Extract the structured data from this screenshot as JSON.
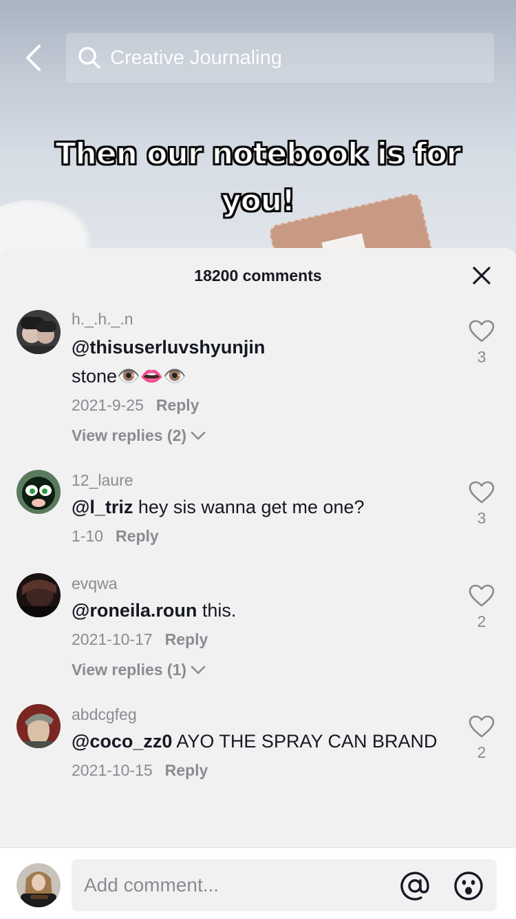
{
  "search": {
    "placeholder": "Creative Journaling"
  },
  "video": {
    "caption_line1": "Then our notebook is for",
    "caption_line2": "you!"
  },
  "comments_panel": {
    "title": "18200 comments",
    "reply_label": "Reply",
    "comments": [
      {
        "username": "h._.h._.n",
        "mention": "@thisuserluvshyunjin",
        "text": "",
        "text_line2": "stone👁️👄👁️",
        "date": "2021-9-25",
        "likes": "3",
        "view_replies": "View replies (2)"
      },
      {
        "username": "12_laure",
        "mention": "@l_triz",
        "text": " hey sis wanna get me one?",
        "date": "1-10",
        "likes": "3"
      },
      {
        "username": "evqwa",
        "mention": "@roneila.roun",
        "text": " this.",
        "date": "2021-10-17",
        "likes": "2",
        "view_replies": "View replies (1)"
      },
      {
        "username": "abdcgfeg",
        "mention": "@coco_zz0",
        "text": " AYO THE SPRAY CAN BRAND",
        "date": "2021-10-15",
        "likes": "2"
      }
    ]
  },
  "composer": {
    "placeholder": "Add comment..."
  },
  "colors": {
    "sheet_bg": "#f1f1f2",
    "text_primary": "#161823",
    "text_secondary": "#8a8b91"
  },
  "icons": [
    "back-arrow-icon",
    "search-icon",
    "close-icon",
    "heart-icon",
    "chevron-down-icon",
    "at-sign-icon",
    "emoji-icon"
  ]
}
